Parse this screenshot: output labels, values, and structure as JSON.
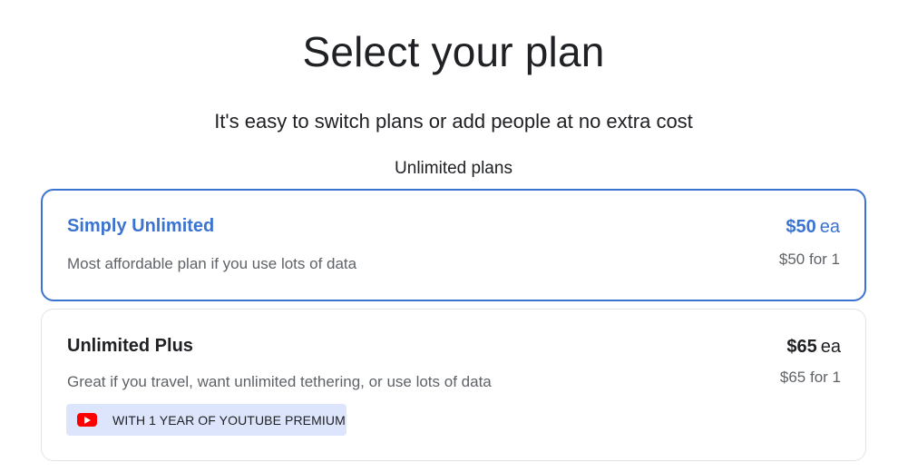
{
  "header": {
    "title": "Select your plan",
    "subtitle": "It's easy to switch plans or add people at no extra cost",
    "section_label": "Unlimited plans"
  },
  "plans": [
    {
      "name": "Simply Unlimited",
      "description": "Most affordable plan if you use lots of data",
      "price_amount": "$50",
      "price_unit": "ea",
      "price_total": "$50 for 1",
      "selected": true
    },
    {
      "name": "Unlimited Plus",
      "description": "Great if you travel, want unlimited tethering, or use lots of data",
      "price_amount": "$65",
      "price_unit": "ea",
      "price_total": "$65 for 1",
      "selected": false,
      "badge": {
        "icon": "youtube-icon",
        "text": "WITH 1 YEAR OF YOUTUBE PREMIUM"
      }
    }
  ],
  "colors": {
    "accent": "#3b73d1",
    "badge_bg": "#dce5fb",
    "youtube_red": "#ff0000"
  }
}
